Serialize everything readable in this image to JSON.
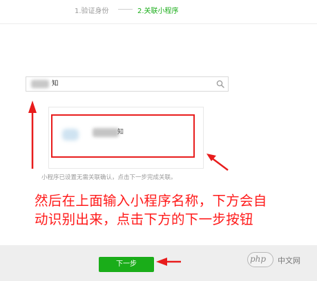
{
  "steps": {
    "step1_label": "1.验证身份",
    "step2_label": "2.关联小程序",
    "active_color": "#1aad19"
  },
  "search": {
    "value_visible": "知",
    "icon": "search-icon"
  },
  "result": {
    "app_name_visible": "知",
    "icon": "mini-program-icon"
  },
  "hint": "小程序已设置无需关联确认，点击下一步完成关联。",
  "annotation": {
    "line1": "然后在上面输入小程序名称，下方会自",
    "line2": "动识别出来，点击下方的下一步按钮",
    "color": "#ff1a1a"
  },
  "next_button": {
    "label": "下一步",
    "color": "#1aad19"
  },
  "watermark": {
    "logo": "php",
    "text": "中文网"
  }
}
